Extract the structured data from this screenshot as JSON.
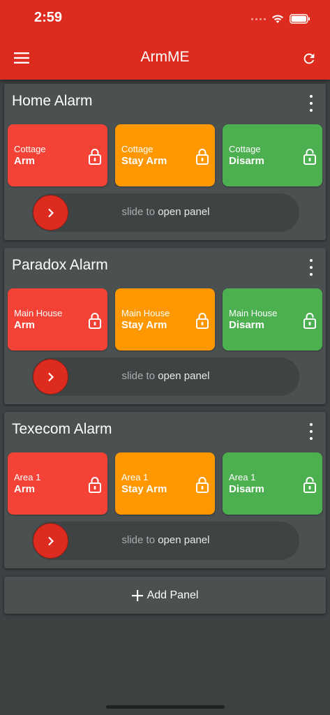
{
  "status_bar": {
    "time": "2:59"
  },
  "app_bar": {
    "title": "ArmME"
  },
  "colors": {
    "accent": "#dd2c1f",
    "arm": "#f44336",
    "stay_arm": "#ff9800",
    "disarm": "#4caf50"
  },
  "panels": [
    {
      "title": "Home Alarm",
      "actions": [
        {
          "area": "Cottage",
          "mode": "Arm",
          "icon": "lock-icon"
        },
        {
          "area": "Cottage",
          "mode": "Stay Arm",
          "icon": "lock-icon"
        },
        {
          "area": "Cottage",
          "mode": "Disarm",
          "icon": "unlock-icon"
        }
      ],
      "slider": {
        "text_part1": "slide to",
        "text_part2": "open panel"
      }
    },
    {
      "title": "Paradox Alarm",
      "actions": [
        {
          "area": "Main House",
          "mode": "Arm",
          "icon": "lock-icon"
        },
        {
          "area": "Main House",
          "mode": "Stay Arm",
          "icon": "lock-icon"
        },
        {
          "area": "Main House",
          "mode": "Disarm",
          "icon": "unlock-icon"
        }
      ],
      "slider": {
        "text_part1": "slide to",
        "text_part2": "open panel"
      }
    },
    {
      "title": "Texecom Alarm",
      "actions": [
        {
          "area": "Area 1",
          "mode": "Arm",
          "icon": "lock-icon"
        },
        {
          "area": "Area 1",
          "mode": "Stay Arm",
          "icon": "lock-icon"
        },
        {
          "area": "Area 1",
          "mode": "Disarm",
          "icon": "unlock-icon"
        }
      ],
      "slider": {
        "text_part1": "slide to",
        "text_part2": "open panel"
      }
    }
  ],
  "add_panel": {
    "label": "Add Panel"
  }
}
